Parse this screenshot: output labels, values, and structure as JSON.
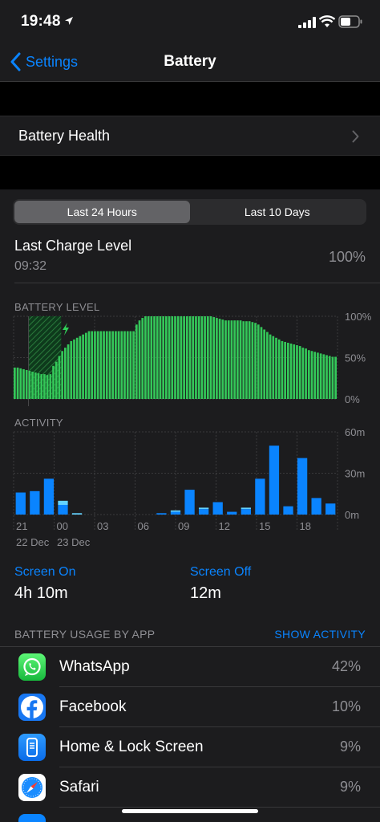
{
  "status": {
    "time": "19:48"
  },
  "nav": {
    "back_label": "Settings",
    "title": "Battery"
  },
  "health": {
    "label": "Battery Health"
  },
  "segment": {
    "options": [
      "Last 24 Hours",
      "Last 10 Days"
    ],
    "selected": 0
  },
  "last_charge": {
    "title": "Last Charge Level",
    "time": "09:32",
    "value": "100%"
  },
  "battery_level": {
    "label": "BATTERY LEVEL",
    "y_ticks": [
      "100%",
      "50%",
      "0%"
    ]
  },
  "activity": {
    "label": "ACTIVITY",
    "y_ticks": [
      "60m",
      "30m",
      "0m"
    ],
    "x_ticks": [
      "21",
      "00",
      "03",
      "06",
      "09",
      "12",
      "15",
      "18"
    ],
    "dates": [
      "22 Dec",
      "23 Dec"
    ]
  },
  "screen": {
    "on_label": "Screen On",
    "on_value": "4h 10m",
    "off_label": "Screen Off",
    "off_value": "12m"
  },
  "usage": {
    "header": "BATTERY USAGE BY APP",
    "action": "SHOW ACTIVITY",
    "apps": [
      {
        "name": "WhatsApp",
        "pct": "42%",
        "icon": "whatsapp-icon",
        "color": "#25d366"
      },
      {
        "name": "Facebook",
        "pct": "10%",
        "icon": "facebook-icon",
        "color": "#1877f2"
      },
      {
        "name": "Home & Lock Screen",
        "pct": "9%",
        "icon": "home-lock-screen-icon",
        "color": "#0a84ff"
      },
      {
        "name": "Safari",
        "pct": "9%",
        "icon": "safari-icon",
        "color": "#ffffff"
      }
    ]
  },
  "colors": {
    "accent": "#0a84ff",
    "battery_green": "#34c759",
    "charging_green": "#30d158"
  },
  "chart_data": [
    {
      "type": "bar",
      "title": "BATTERY LEVEL",
      "ylim": [
        0,
        100
      ],
      "y_ticks": [
        "100%",
        "50%",
        "0%"
      ],
      "charging_interval": [
        5,
        16
      ],
      "values": [
        38,
        38,
        37,
        36,
        35,
        34,
        33,
        32,
        31,
        30,
        30,
        29,
        30,
        40,
        45,
        52,
        58,
        62,
        66,
        70,
        72,
        74,
        76,
        78,
        80,
        82,
        82,
        82,
        82,
        82,
        82,
        82,
        82,
        82,
        82,
        82,
        82,
        82,
        82,
        82,
        82,
        90,
        95,
        98,
        100,
        100,
        100,
        100,
        100,
        100,
        100,
        100,
        100,
        100,
        100,
        100,
        100,
        100,
        100,
        100,
        100,
        100,
        100,
        100,
        100,
        100,
        100,
        99,
        98,
        97,
        96,
        95,
        95,
        95,
        95,
        95,
        95,
        94,
        94,
        94,
        93,
        92,
        90,
        87,
        84,
        81,
        78,
        76,
        74,
        72,
        70,
        69,
        68,
        67,
        66,
        65,
        64,
        62,
        61,
        59,
        58,
        57,
        56,
        55,
        54,
        53,
        52,
        51,
        51
      ]
    },
    {
      "type": "bar",
      "title": "ACTIVITY",
      "ylim": [
        0,
        60
      ],
      "x_ticks": [
        "21",
        "00",
        "03",
        "06",
        "09",
        "12",
        "15",
        "18"
      ],
      "series": [
        {
          "name": "Screen On",
          "values": [
            16,
            17,
            26,
            7,
            0,
            0,
            0,
            0,
            0,
            0,
            1,
            2,
            18,
            4,
            9,
            2,
            4,
            26,
            50,
            6,
            41,
            12,
            8
          ]
        },
        {
          "name": "Screen Off",
          "values": [
            0,
            0,
            0,
            3,
            1,
            0,
            0,
            0,
            0,
            0,
            0,
            1,
            0,
            1,
            0,
            0,
            1,
            0,
            0,
            0,
            0,
            0,
            0
          ]
        }
      ]
    }
  ]
}
